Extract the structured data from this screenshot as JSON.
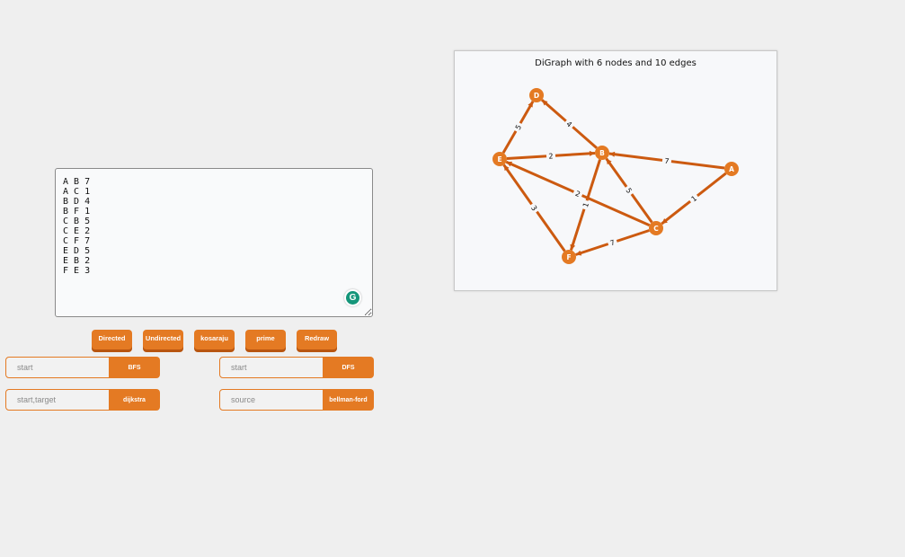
{
  "editor": {
    "edges_text": "A B 7\nA C 1\nB D 4\nB F 1\nC B 5\nC E 2\nC F 7\nE D 5\nE B 2\nF E 3",
    "grammarly_glyph": "G"
  },
  "toolbar": {
    "directed_label": "Directed",
    "undirected_label": "Undirected",
    "kosaraju_label": "kosaraju",
    "prime_label": "prime",
    "redraw_label": "Redraw"
  },
  "bfs": {
    "placeholder": "start",
    "button_label": "BFS"
  },
  "dfs": {
    "placeholder": "start",
    "button_label": "DFS"
  },
  "dijkstra": {
    "placeholder": "start,target",
    "button_label": "dijkstra"
  },
  "bellman": {
    "placeholder": "source",
    "button_label": "bellman-ford"
  },
  "graph": {
    "title": "DiGraph with 6 nodes and 10 edges",
    "node_color": "#e47a23",
    "edge_color": "#cc5a10",
    "nodes": [
      "A",
      "B",
      "C",
      "D",
      "E",
      "F"
    ],
    "edges": [
      {
        "source": "A",
        "target": "B",
        "weight": "7"
      },
      {
        "source": "A",
        "target": "C",
        "weight": "1"
      },
      {
        "source": "B",
        "target": "D",
        "weight": "4"
      },
      {
        "source": "B",
        "target": "F",
        "weight": "1"
      },
      {
        "source": "C",
        "target": "B",
        "weight": "5"
      },
      {
        "source": "C",
        "target": "E",
        "weight": "2"
      },
      {
        "source": "C",
        "target": "F",
        "weight": "7"
      },
      {
        "source": "E",
        "target": "D",
        "weight": "5"
      },
      {
        "source": "E",
        "target": "B",
        "weight": "2"
      },
      {
        "source": "F",
        "target": "E",
        "weight": "3"
      }
    ]
  }
}
